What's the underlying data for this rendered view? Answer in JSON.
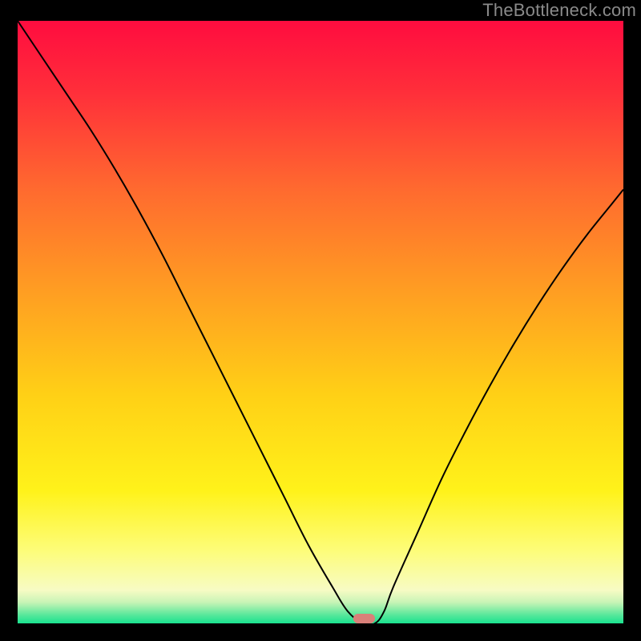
{
  "watermark": "TheBottleneck.com",
  "chart_data": {
    "type": "line",
    "title": "",
    "xlabel": "",
    "ylabel": "",
    "xlim": [
      0,
      100
    ],
    "ylim": [
      0,
      100
    ],
    "background_gradient": {
      "stops": [
        {
          "offset": 0.0,
          "color": "#ff0c3f"
        },
        {
          "offset": 0.12,
          "color": "#ff2f3a"
        },
        {
          "offset": 0.28,
          "color": "#ff6a2f"
        },
        {
          "offset": 0.45,
          "color": "#ff9e22"
        },
        {
          "offset": 0.62,
          "color": "#ffd016"
        },
        {
          "offset": 0.78,
          "color": "#fff21a"
        },
        {
          "offset": 0.88,
          "color": "#fdfd7a"
        },
        {
          "offset": 0.945,
          "color": "#f7fbc4"
        },
        {
          "offset": 0.965,
          "color": "#c8f4b6"
        },
        {
          "offset": 0.985,
          "color": "#5de89c"
        },
        {
          "offset": 1.0,
          "color": "#19e28f"
        }
      ]
    },
    "curve": {
      "x": [
        0,
        4,
        8,
        12,
        16,
        20,
        24,
        28,
        32,
        36,
        40,
        44,
        48,
        52,
        54.5,
        57,
        59,
        60.5,
        62,
        66,
        70,
        74,
        78,
        82,
        86,
        90,
        94,
        98,
        100
      ],
      "y": [
        100,
        94,
        88,
        82,
        75.5,
        68.5,
        61,
        53,
        45,
        37,
        29,
        21,
        13,
        6,
        2,
        0,
        0,
        2,
        6,
        15,
        24,
        32,
        39.5,
        46.5,
        53,
        59,
        64.5,
        69.5,
        72
      ]
    },
    "marker": {
      "x": 57.2,
      "y": 0.8,
      "width": 3.6,
      "height": 1.6,
      "color": "#d98079"
    }
  }
}
